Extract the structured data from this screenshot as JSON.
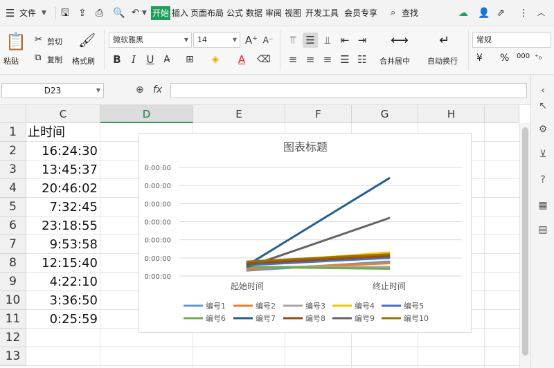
{
  "menubar": {
    "file": "文件",
    "tabs": [
      "开始",
      "插入",
      "页面布局",
      "公式",
      "数据",
      "审阅",
      "视图",
      "开发工具",
      "会员专享"
    ],
    "search": "查找"
  },
  "ribbon": {
    "paste": "粘贴",
    "cut": "剪切",
    "copy": "复制",
    "format_painter": "格式刷",
    "font_name": "微软雅黑",
    "font_size": "14",
    "merge_center": "合并居中",
    "wrap_text": "自动换行",
    "number_format": "常规",
    "percent": "%",
    "thousands": "000",
    "bold": "B",
    "italic": "I",
    "underline": "U",
    "font_color": "A"
  },
  "formula_bar": {
    "cell_ref": "D23",
    "fx": "fx",
    "content": ""
  },
  "sheet": {
    "columns": [
      "C",
      "D",
      "E",
      "F",
      "G",
      "H"
    ],
    "selected_column": "D",
    "rows": [
      "1",
      "2",
      "3",
      "4",
      "5",
      "6",
      "7",
      "8",
      "9",
      "10",
      "11",
      "12",
      "13"
    ],
    "col_c": [
      "止时间",
      "16:24:30",
      "13:45:37",
      "20:46:02",
      "7:32:45",
      "23:18:55",
      "9:53:58",
      "12:15:40",
      "4:22:10",
      "3:36:50",
      "0:25:59",
      "",
      ""
    ]
  },
  "chart_data": {
    "type": "line",
    "title": "图表标题",
    "categories": [
      "起始时间",
      "终止时间"
    ],
    "y_tick_labels": [
      "0:00:00",
      "0:00:00",
      "0:00:00",
      "0:00:00",
      "0:00:00",
      "0:00:00",
      "0:00:00"
    ],
    "ylim": [
      0,
      0.6
    ],
    "legend_position": "bottom",
    "series": [
      {
        "name": "编号1",
        "color": "#5B9BD5",
        "values": [
          0.03,
          0.08
        ]
      },
      {
        "name": "编号2",
        "color": "#ED7D31",
        "values": [
          0.04,
          0.07
        ]
      },
      {
        "name": "编号3",
        "color": "#A5A5A5",
        "values": [
          0.05,
          0.05
        ]
      },
      {
        "name": "编号4",
        "color": "#FFC000",
        "values": [
          0.07,
          0.13
        ]
      },
      {
        "name": "编号5",
        "color": "#4472C4",
        "values": [
          0.06,
          0.1
        ]
      },
      {
        "name": "编号6",
        "color": "#70AD47",
        "values": [
          0.05,
          0.04
        ]
      },
      {
        "name": "编号7",
        "color": "#255E91",
        "values": [
          0.06,
          0.54
        ]
      },
      {
        "name": "编号8",
        "color": "#9E480E",
        "values": [
          0.07,
          0.11
        ]
      },
      {
        "name": "编号9",
        "color": "#636363",
        "values": [
          0.05,
          0.32
        ]
      },
      {
        "name": "编号10",
        "color": "#997300",
        "values": [
          0.08,
          0.12
        ]
      }
    ]
  }
}
